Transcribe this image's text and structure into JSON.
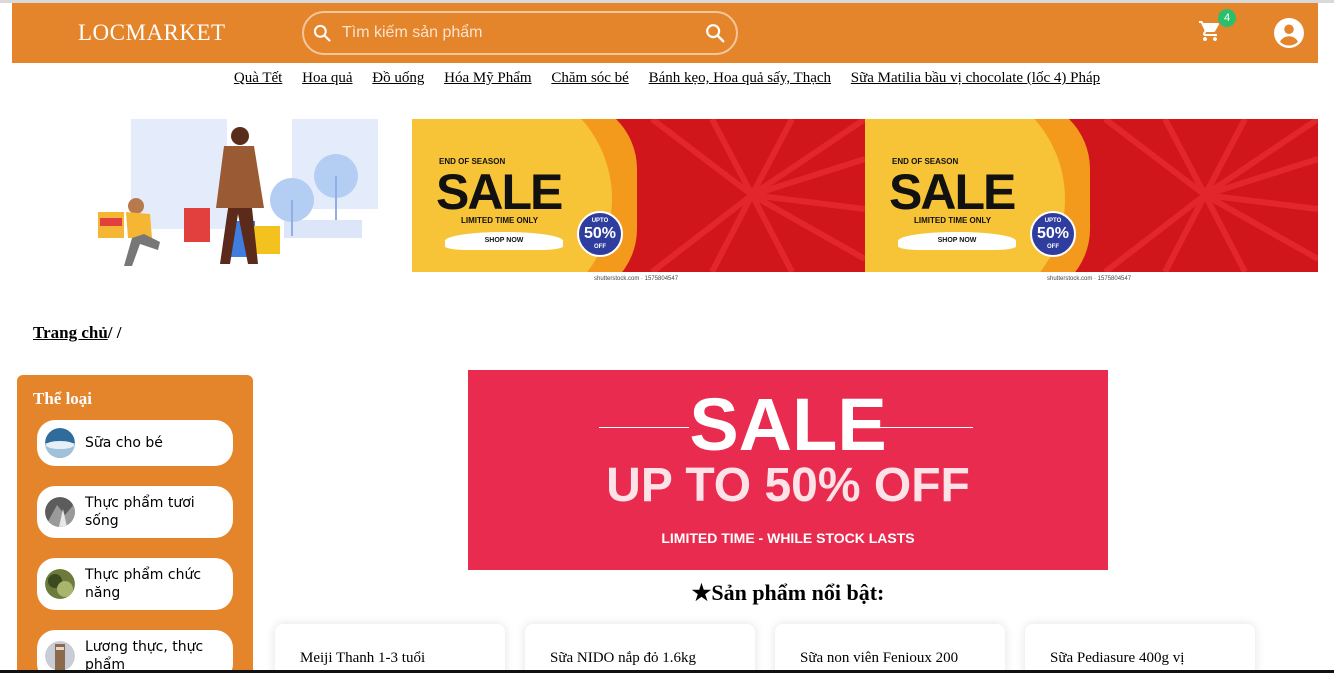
{
  "header": {
    "logo": "LOCMARKET",
    "search_placeholder": "Tìm kiếm sản phẩm",
    "cart_count": "4"
  },
  "nav_links": [
    "Quà Tết",
    "Hoa quả",
    "Đồ uống",
    "Hóa Mỹ Phẩm",
    "Chăm sóc bé",
    "Bánh kẹo, Hoa quả sấy, Thạch",
    "Sữa Matilia bầu vị chocolate (lốc 4) Pháp"
  ],
  "banner": {
    "eyebrow": "END OF SEASON",
    "headline": "SALE",
    "subline": "LIMITED TIME ONLY",
    "cta": "SHOP NOW",
    "badge_top": "UPTO",
    "badge_value": "50%",
    "badge_bottom": "OFF",
    "credit": "shutterstock.com · 1575804547"
  },
  "breadcrumb": {
    "home": "Trang chủ",
    "separator": "/ /"
  },
  "sidebar": {
    "title": "Thể loại",
    "items": [
      {
        "label": "Sữa cho bé"
      },
      {
        "label": "Thực phẩm tươi sống"
      },
      {
        "label": "Thực phẩm chức năng"
      },
      {
        "label": "Lương thực, thực phẩm"
      }
    ]
  },
  "promo": {
    "headline": "SALE",
    "subline": "UP TO 50% OFF",
    "note": "LIMITED TIME - WHILE STOCK LASTS"
  },
  "featured_title": "★Sản phẩm nổi bật:",
  "products": [
    {
      "name": "Meiji Thanh 1-3 tuổi"
    },
    {
      "name": "Sữa NIDO nắp đỏ 1.6kg"
    },
    {
      "name": "Sữa non viên Fenioux 200"
    },
    {
      "name": "Sữa Pediasure 400g vị"
    }
  ],
  "colors": {
    "brand_orange": "#e5852b",
    "promo_pink": "#e92b4f",
    "banner_red": "#d0151b",
    "banner_yellow": "#f6c436",
    "badge_green": "#2bbf6b"
  }
}
